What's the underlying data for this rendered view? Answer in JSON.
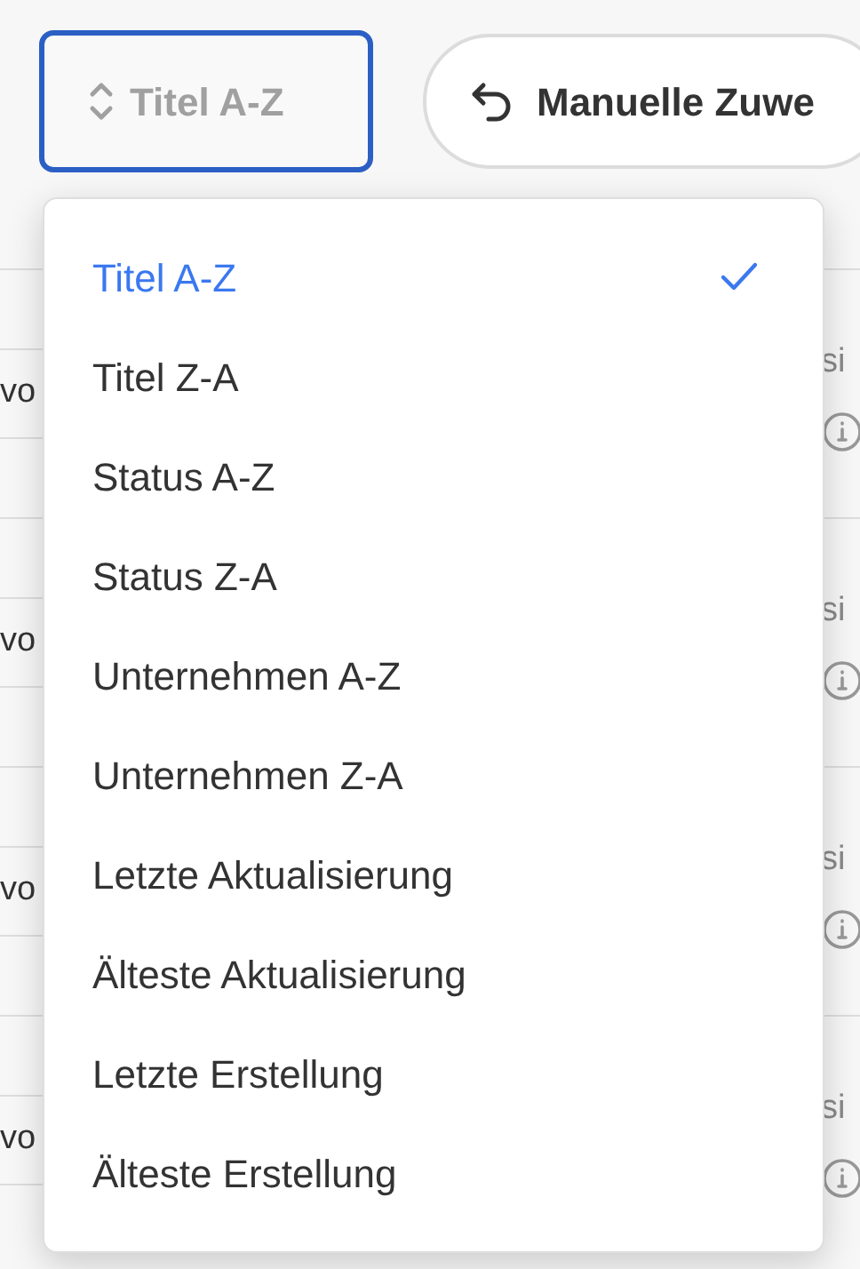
{
  "toolbar": {
    "sort_button": {
      "label": "Titel A-Z"
    },
    "manual_button": {
      "label": "Manuelle Zuwe"
    }
  },
  "rows": [
    {
      "left_text": "vo",
      "right_text": "si"
    },
    {
      "left_text": "vo",
      "right_text": "si"
    },
    {
      "left_text": "vo",
      "right_text": "si"
    },
    {
      "left_text": "vo",
      "right_text": "si"
    }
  ],
  "sort_menu": {
    "items": [
      {
        "label": "Titel A-Z",
        "selected": true
      },
      {
        "label": "Titel Z-A",
        "selected": false
      },
      {
        "label": "Status A-Z",
        "selected": false
      },
      {
        "label": "Status Z-A",
        "selected": false
      },
      {
        "label": "Unternehmen A-Z",
        "selected": false
      },
      {
        "label": "Unternehmen Z-A",
        "selected": false
      },
      {
        "label": "Letzte Aktualisierung",
        "selected": false
      },
      {
        "label": "Älteste Aktualisierung",
        "selected": false
      },
      {
        "label": "Letzte Erstellung",
        "selected": false
      },
      {
        "label": "Älteste Erstellung",
        "selected": false
      }
    ]
  }
}
